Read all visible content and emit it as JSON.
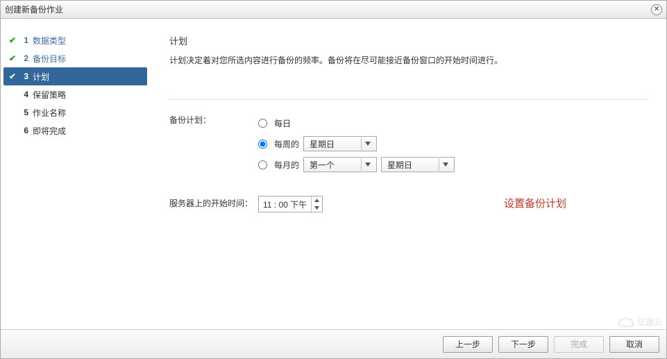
{
  "window": {
    "title": "创建新备份作业"
  },
  "sidebar": {
    "steps": [
      {
        "num": "1",
        "label": "数据类型",
        "state": "done"
      },
      {
        "num": "2",
        "label": "备份目标",
        "state": "done"
      },
      {
        "num": "3",
        "label": "计划",
        "state": "current"
      },
      {
        "num": "4",
        "label": "保留策略",
        "state": "future"
      },
      {
        "num": "5",
        "label": "作业名称",
        "state": "future"
      },
      {
        "num": "6",
        "label": "即将完成",
        "state": "future"
      }
    ]
  },
  "main": {
    "heading": "计划",
    "description": "计划决定着对您所选内容进行备份的频率。备份将在尽可能接近备份窗口的开始时间进行。",
    "schedule_label": "备份计划：",
    "radios": {
      "daily": {
        "label": "每日",
        "checked": false
      },
      "weekly": {
        "label": "每周的",
        "checked": true,
        "day_select": "星期日"
      },
      "monthly": {
        "label": "每月的",
        "checked": false,
        "ordinal_select": "第一个",
        "day_select": "星期日"
      }
    },
    "start_time_label": "服务器上的开始时间：",
    "start_time_value": "11 : 00 下午",
    "annotation": "设置备份计划"
  },
  "footer": {
    "back": "上一步",
    "next": "下一步",
    "finish": "完成",
    "cancel": "取消"
  },
  "watermark": "亿速云"
}
